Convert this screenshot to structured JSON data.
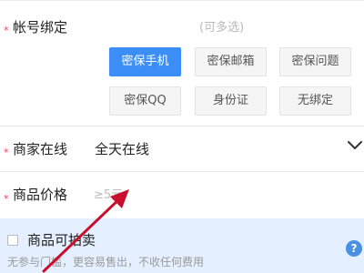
{
  "account_binding": {
    "label": "帐号绑定",
    "hint": "(可多选)",
    "options": [
      "密保手机",
      "密保邮箱",
      "密保问题",
      "密保QQ",
      "身份证",
      "无绑定"
    ],
    "selected": "密保手机"
  },
  "seller_online": {
    "label": "商家在线",
    "value": "全天在线",
    "icon": "chevron-down-icon"
  },
  "price": {
    "label": "商品价格",
    "placeholder": "≥5元"
  },
  "auction": {
    "checkbox_label": "商品可拍卖",
    "checked": false,
    "description": "无参与门槛，更容易售出，不收任何费用",
    "help_icon": "question-icon",
    "help_symbol": "?"
  },
  "required_marker": "*",
  "colors": {
    "accent": "#3b8ef5",
    "required": "#e5455b",
    "panel_bg": "#e4efff",
    "annotation_arrow": "#c8102e"
  }
}
